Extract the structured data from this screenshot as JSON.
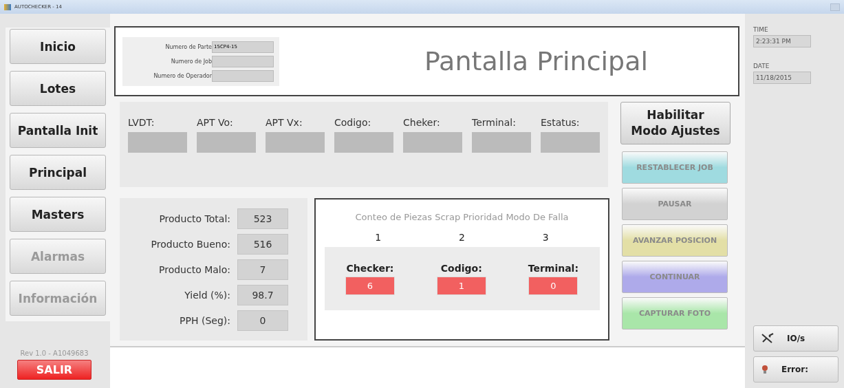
{
  "window": {
    "title": "AUTOCHECKER - 14"
  },
  "nav": [
    {
      "label": "Inicio",
      "disabled": false
    },
    {
      "label": "Lotes",
      "disabled": false
    },
    {
      "label": "Pantalla Init",
      "disabled": false
    },
    {
      "label": "Principal",
      "disabled": false
    },
    {
      "label": "Masters",
      "disabled": false
    },
    {
      "label": "Alarmas",
      "disabled": true
    },
    {
      "label": "Información",
      "disabled": true
    }
  ],
  "revision": "Rev 1.0 - A1049683",
  "exit_button": "SALIR",
  "part_form": [
    {
      "label": "Numero de Parte",
      "value": "15CP4-15"
    },
    {
      "label": "Numero de Job"
    },
    {
      "label": "Numero de Operador"
    }
  ],
  "page_title": "Pantalla Principal",
  "readings": [
    {
      "label": "LVDT:"
    },
    {
      "label": "APT Vo:"
    },
    {
      "label": "APT Vx:"
    },
    {
      "label": "Codigo:"
    },
    {
      "label": "Cheker:"
    },
    {
      "label": "Terminal:"
    },
    {
      "label": "Estatus:"
    }
  ],
  "adjust_button": {
    "lines": [
      "Habilitar",
      "Modo Ajustes"
    ]
  },
  "stats": [
    {
      "label": "Producto Total:",
      "value": "523"
    },
    {
      "label": "Producto Bueno:",
      "value": "516"
    },
    {
      "label": "Producto Malo:",
      "value": "7"
    },
    {
      "label": "Yield (%):",
      "value": "98.7"
    },
    {
      "label": "PPH (Seg):",
      "value": "0"
    }
  ],
  "scrap": {
    "title": "Conteo de Piezas Scrap Prioridad Modo De Falla",
    "columns": [
      {
        "rank": "1",
        "label": "Checker:",
        "value": "6"
      },
      {
        "rank": "2",
        "label": "Codigo:",
        "value": "1"
      },
      {
        "rank": "3",
        "label": "Terminal:",
        "value": "0"
      }
    ]
  },
  "actions": [
    {
      "label": "RESTABLECER JOB",
      "color": "#9fdbe0",
      "disabled": true
    },
    {
      "label": "PAUSAR",
      "color": "#d2d2d2",
      "disabled": true
    },
    {
      "label": "AVANZAR POSICION",
      "color": "#e3dfa6",
      "disabled": true
    },
    {
      "label": "CONTINUAR",
      "color": "#aeaaea",
      "disabled": true
    },
    {
      "label": "CAPTURAR FOTO",
      "color": "#a9e6a9",
      "disabled": true
    }
  ],
  "time": {
    "label": "TIME",
    "value": "2:23:31 PM"
  },
  "date": {
    "label": "DATE",
    "value": "11/18/2015"
  },
  "io_button": "IO/s",
  "error_button": "Error:"
}
